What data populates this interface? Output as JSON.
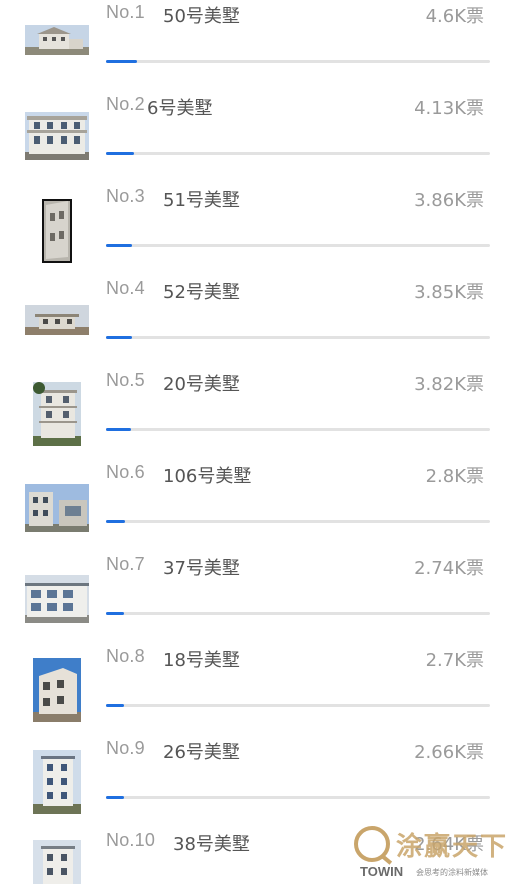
{
  "ranking": [
    {
      "rank": "No.1",
      "name": "50号美墅",
      "votes": "4.6K票",
      "share": 0.08
    },
    {
      "rank": "No.2",
      "name": "6号美墅",
      "votes": "4.13K票",
      "share": 0.072
    },
    {
      "rank": "No.3",
      "name": "51号美墅",
      "votes": "3.86K票",
      "share": 0.067
    },
    {
      "rank": "No.4",
      "name": "52号美墅",
      "votes": "3.85K票",
      "share": 0.067
    },
    {
      "rank": "No.5",
      "name": "20号美墅",
      "votes": "3.82K票",
      "share": 0.066
    },
    {
      "rank": "No.6",
      "name": "106号美墅",
      "votes": "2.8K票",
      "share": 0.049
    },
    {
      "rank": "No.7",
      "name": "37号美墅",
      "votes": "2.74K票",
      "share": 0.048
    },
    {
      "rank": "No.8",
      "name": "18号美墅",
      "votes": "2.7K票",
      "share": 0.047
    },
    {
      "rank": "No.9",
      "name": "26号美墅",
      "votes": "2.66K票",
      "share": 0.046
    },
    {
      "rank": "No.10",
      "name": "38号美墅",
      "votes": "2.64K票",
      "share": 0.046
    }
  ],
  "watermark": {
    "cn": "涂赢天下",
    "brand": "TOWIN",
    "tagline": "会思考的涂料新媒体"
  },
  "colors": {
    "bar_fill": "#1f6fe0",
    "bar_track": "#e2e2e2",
    "watermark": "#c9a56b"
  }
}
